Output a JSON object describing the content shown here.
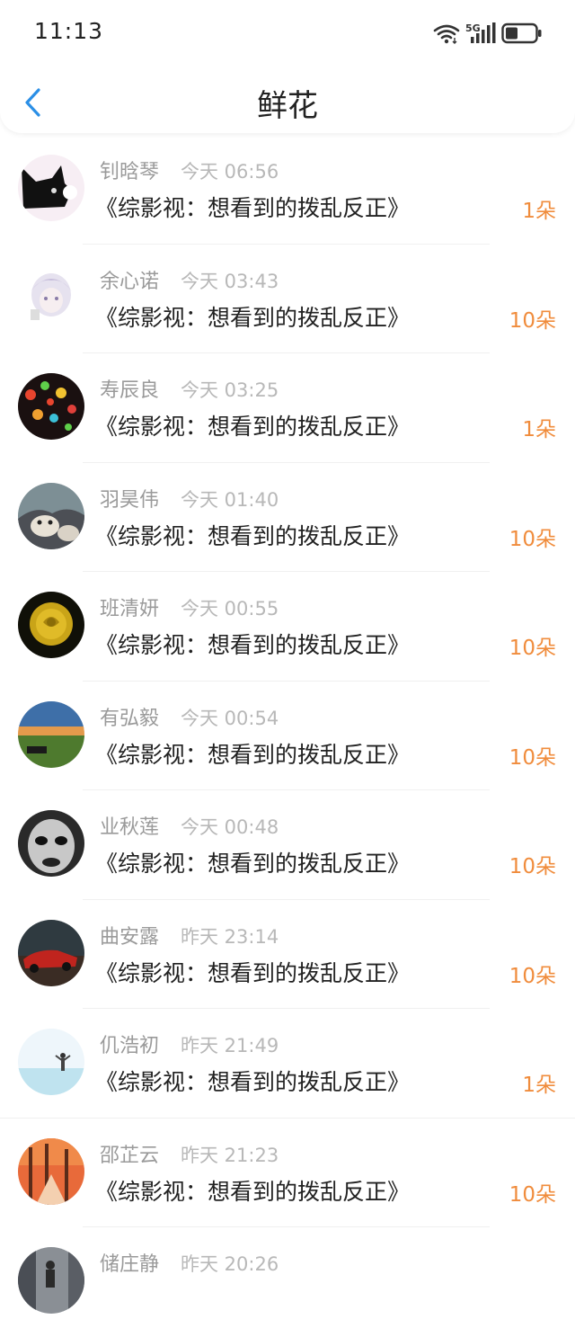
{
  "status_bar": {
    "time": "11:13",
    "network": "5G",
    "icons": [
      "wifi-icon",
      "signal-5g-icon",
      "battery-icon"
    ]
  },
  "header": {
    "title": "鲜花",
    "back_icon": "chevron-left-icon"
  },
  "colors": {
    "accent": "#2b8fe6",
    "amount": "#f08c3c",
    "name": "#9a9a9a",
    "time": "#b8b8b8"
  },
  "records": [
    {
      "name": "钊晗琴",
      "time": "今天 06:56",
      "book": "《综影视：想看到的拨乱反正》",
      "amount": "1朵",
      "avatar": "black-cat-avatar"
    },
    {
      "name": "余心诺",
      "time": "今天 03:43",
      "book": "《综影视：想看到的拨乱反正》",
      "amount": "10朵",
      "avatar": "anime-character-avatar"
    },
    {
      "name": "寿辰良",
      "time": "今天 03:25",
      "book": "《综影视：想看到的拨乱反正》",
      "amount": "1朵",
      "avatar": "bokeh-lights-avatar"
    },
    {
      "name": "羽昊伟",
      "time": "今天 01:40",
      "book": "《综影视：想看到的拨乱反正》",
      "amount": "10朵",
      "avatar": "husky-dog-avatar"
    },
    {
      "name": "班清妍",
      "time": "今天 00:55",
      "book": "《综影视：想看到的拨乱反正》",
      "amount": "10朵",
      "avatar": "yellow-rose-avatar"
    },
    {
      "name": "有弘毅",
      "time": "今天 00:54",
      "book": "《综影视：想看到的拨乱反正》",
      "amount": "10朵",
      "avatar": "sunset-landscape-avatar"
    },
    {
      "name": "业秋莲",
      "time": "今天 00:48",
      "book": "《综影视：想看到的拨乱反正》",
      "amount": "10朵",
      "avatar": "mask-face-avatar"
    },
    {
      "name": "曲安露",
      "time": "昨天 23:14",
      "book": "《综影视：想看到的拨乱反正》",
      "amount": "10朵",
      "avatar": "red-sports-car-avatar"
    },
    {
      "name": "仉浩初",
      "time": "昨天 21:49",
      "book": "《综影视：想看到的拨乱反正》",
      "amount": "1朵",
      "avatar": "beach-person-avatar"
    },
    {
      "name": "邵芷云",
      "time": "昨天 21:23",
      "book": "《综影视：想看到的拨乱反正》",
      "amount": "10朵",
      "avatar": "autumn-forest-avatar"
    },
    {
      "name": "储庄静",
      "time": "昨天 20:26",
      "book": "",
      "amount": "",
      "avatar": "city-street-avatar"
    }
  ]
}
